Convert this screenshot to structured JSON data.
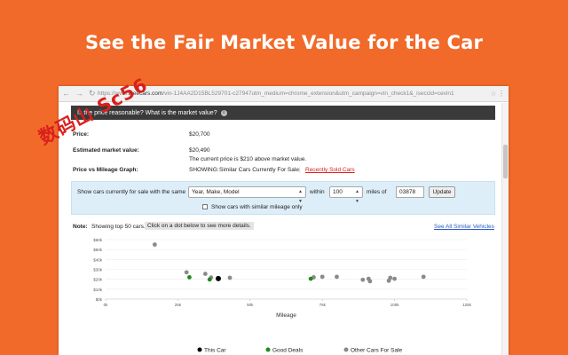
{
  "headline": "See the Fair Market Value for the Car",
  "watermark_text": "数码山 Sc56",
  "browser": {
    "url_prefix": "https://www.",
    "url_domain": "iseecars.com",
    "url_rest": "/vin-1J4AA2D15BL529701-c27947utm_medium=chrome_extension&utm_campaign=vin_check1&_iseccid=cevin1",
    "back_icon": "arrow-left-icon",
    "forward_icon": "arrow-right-icon",
    "reload_icon": "reload-icon"
  },
  "header": {
    "question": "Is the price reasonable? What is the market value?"
  },
  "price": {
    "label": "Price:",
    "value": "$20,700"
  },
  "market": {
    "label": "Estimated market value:",
    "value": "$20,490",
    "note": "The current price is $210 above market value."
  },
  "graph_row": {
    "label": "Price vs Mileage Graph:",
    "showing": "SHOWING:",
    "option_current": "Similar Cars Currently For Sale",
    "option_sold": "Recently Sold Cars"
  },
  "filter": {
    "prefix": "Show cars currently for sale with the same",
    "match_value": "Year, Make, Model",
    "within_label": "within",
    "distance_value": "100",
    "miles_label": "miles of",
    "zip_value": "03878",
    "update_label": "Update",
    "checkbox_label": "Show cars with similar mileage only"
  },
  "note": {
    "label": "Note:",
    "text": "Showing top 50 cars.",
    "hint": "Click on a dot below to see more details.",
    "see_all": "See All Similar Vehicles"
  },
  "legend": {
    "this_car": "This Car",
    "good_deals": "Good Deals",
    "other_cars": "Other Cars For Sale"
  },
  "colors": {
    "background": "#f26a2a",
    "this_car": "#000000",
    "good_deal": "#1e8c1e",
    "other": "#8a8a8a",
    "link": "#d9201c"
  },
  "chart_data": {
    "type": "scatter",
    "xlabel": "Mileage",
    "ylabel": "",
    "xlim": [
      0,
      125000
    ],
    "ylim": [
      0,
      60000
    ],
    "x_ticks": [
      0,
      25000,
      50000,
      75000,
      100000,
      125000
    ],
    "x_tick_labels": [
      "0k",
      "25k",
      "50k",
      "75k",
      "100k",
      "125k"
    ],
    "y_ticks": [
      0,
      10000,
      20000,
      30000,
      40000,
      50000,
      60000
    ],
    "y_tick_labels": [
      "$0k",
      "$10k",
      "$20k",
      "$30k",
      "$40k",
      "$50k",
      "$60k"
    ],
    "grid": true,
    "legend_position": "bottom",
    "series": [
      {
        "name": "This Car",
        "points": [
          [
            39000,
            20700
          ]
        ]
      },
      {
        "name": "Good Deals",
        "points": [
          [
            29000,
            22000
          ],
          [
            36000,
            19800
          ],
          [
            71000,
            20500
          ]
        ]
      },
      {
        "name": "Other Cars For Sale",
        "points": [
          [
            17000,
            55000
          ],
          [
            28000,
            27000
          ],
          [
            34500,
            25500
          ],
          [
            36500,
            21800
          ],
          [
            43000,
            21500
          ],
          [
            72000,
            22000
          ],
          [
            75000,
            22500
          ],
          [
            80000,
            22500
          ],
          [
            89000,
            19500
          ],
          [
            91000,
            20500
          ],
          [
            91500,
            18000
          ],
          [
            98000,
            18500
          ],
          [
            98500,
            21500
          ],
          [
            100000,
            20500
          ],
          [
            110000,
            22500
          ]
        ]
      }
    ]
  }
}
